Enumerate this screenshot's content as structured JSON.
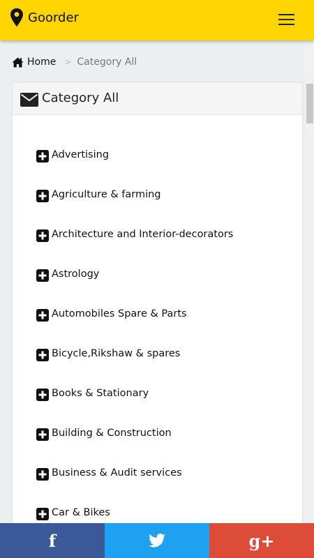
{
  "header": {
    "brand": "Goorder",
    "location_icon": "map-marker-icon",
    "menu_icon": "hamburger-menu-icon",
    "color": "#ffd500"
  },
  "breadcrumb": {
    "home_label": "Home",
    "separator": ">",
    "current": "Category All"
  },
  "panel": {
    "title": "Category All",
    "title_icon": "envelope-icon"
  },
  "categories": [
    {
      "label": "Advertising"
    },
    {
      "label": "Agriculture & farming"
    },
    {
      "label": "Architecture and Interior-decorators"
    },
    {
      "label": "Astrology"
    },
    {
      "label": "Automobiles Spare & Parts"
    },
    {
      "label": "Bicycle,Rikshaw & spares"
    },
    {
      "label": "Books & Stationary"
    },
    {
      "label": "Building & Construction"
    },
    {
      "label": "Business & Audit services"
    },
    {
      "label": "Car & Bikes"
    }
  ],
  "social": {
    "facebook": {
      "glyph": "f",
      "color": "#3b5998"
    },
    "twitter": {
      "icon": "twitter-bird-icon",
      "color": "#1fa1f1"
    },
    "google_plus": {
      "glyph": "g+",
      "color": "#dd4b39"
    }
  }
}
